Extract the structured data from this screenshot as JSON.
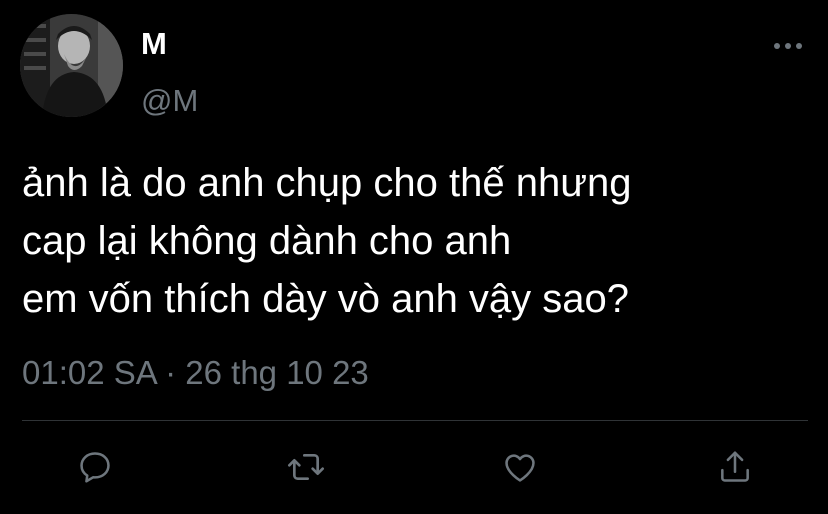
{
  "tweet": {
    "author": {
      "display_name": "M",
      "handle": "@M"
    },
    "text_lines": [
      "ảnh là do anh chụp cho thế nhưng",
      "cap lại không dành cho anh",
      "em vốn thích dày vò anh vậy sao?"
    ],
    "meta": "01:02 SA · 26 thg 10 23"
  },
  "icons": {
    "more": "more-horizontal-icon",
    "reply": "reply-icon",
    "retweet": "retweet-icon",
    "like": "heart-icon",
    "share": "share-icon"
  },
  "colors": {
    "background": "#000000",
    "text": "#ffffff",
    "secondary": "#6e767d",
    "divider": "#2f3336"
  }
}
